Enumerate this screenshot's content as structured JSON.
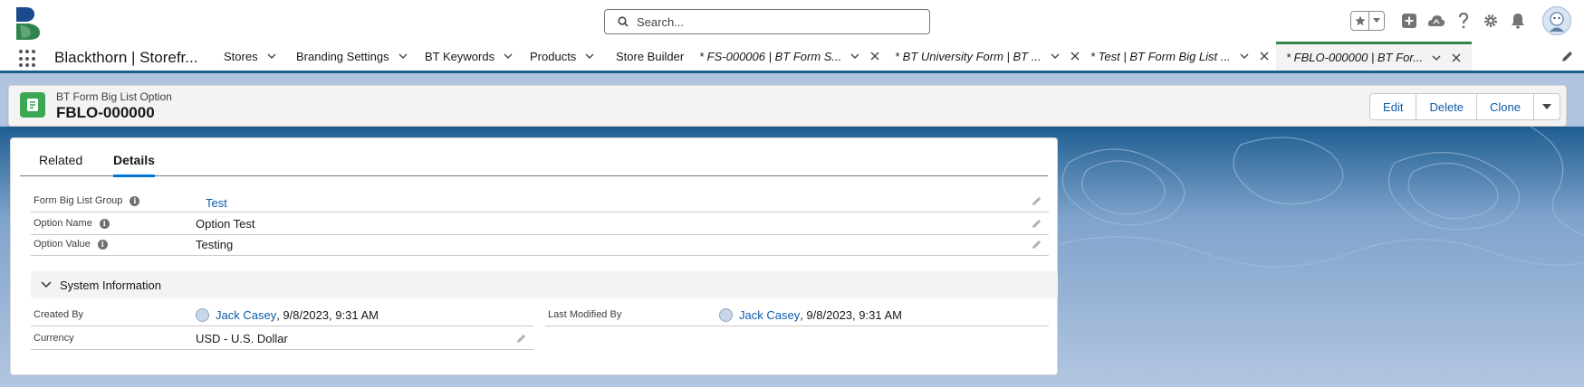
{
  "global_header": {
    "search_placeholder": "Search..."
  },
  "nav": {
    "app_name": "Blackthorn | Storefr...",
    "items": [
      {
        "label": "Stores"
      },
      {
        "label": "Branding Settings"
      },
      {
        "label": "BT Keywords"
      },
      {
        "label": "Products"
      },
      {
        "label": "Store Builder"
      }
    ],
    "tabs": [
      {
        "label": "* FS-000006 | BT Form S..."
      },
      {
        "label": "* BT University Form | BT ..."
      },
      {
        "label": "* Test | BT Form Big List ..."
      },
      {
        "label": "* FBLO-000000 | BT For..."
      }
    ]
  },
  "record": {
    "object_label": "BT Form Big List Option",
    "title": "FBLO-000000",
    "actions": {
      "edit": "Edit",
      "delete": "Delete",
      "clone": "Clone"
    }
  },
  "detail_tabs": {
    "related": "Related",
    "details": "Details"
  },
  "fields": [
    {
      "label": "Form Big List Group",
      "value": "Test"
    },
    {
      "label": "Option Name",
      "value": "Option Test"
    },
    {
      "label": "Option Value",
      "value": "Testing"
    }
  ],
  "system_info": {
    "title": "System Information",
    "created_by_label": "Created By",
    "created_by_user": "Jack Casey",
    "created_by_date": ", 9/8/2023, 9:31 AM",
    "modified_by_label": "Last Modified By",
    "modified_by_user": "Jack Casey",
    "modified_by_date": ", 9/8/2023, 9:31 AM",
    "currency_label": "Currency",
    "currency_value": "USD - U.S. Dollar"
  },
  "colors": {
    "brand_blue": "#0b5cab",
    "nav_accent": "#1b5f8a",
    "active_tab_accent": "#2e844a",
    "object_icon": "#3ba755",
    "background": "#b0c4df"
  }
}
